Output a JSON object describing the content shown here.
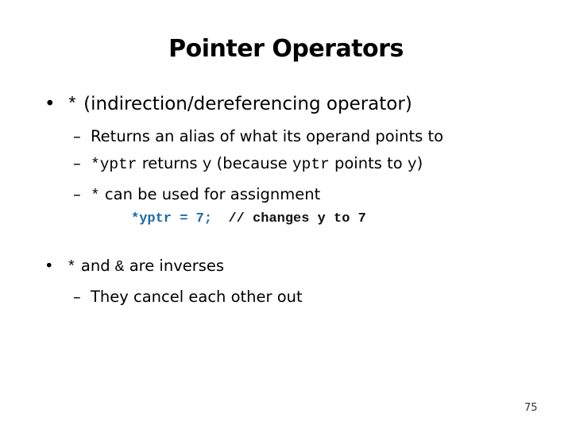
{
  "slide": {
    "title": "Pointer Operators",
    "bullet_symbol": "•",
    "dash_symbol": "–",
    "items": [
      {
        "op": "*",
        "text": " (indirection/dereferencing operator)"
      },
      {
        "text": "Returns an alias of what its operand points to"
      },
      {
        "c1": "*yptr",
        "t1": " returns ",
        "c2": "y",
        "t2": " (because ",
        "c3": "yptr",
        "t3": " points to ",
        "c4": "y",
        "t4": ")"
      },
      {
        "op": "*",
        "text": " can be used for assignment"
      },
      {
        "code": "*yptr = 7;",
        "comment": "// changes y to 7"
      },
      {
        "op1": "*",
        "mid": " and ",
        "op2": "&",
        "text": " are inverses"
      },
      {
        "text": "They cancel each other out"
      }
    ],
    "page_number": "75",
    "colors": {
      "code_accent": "#1a6aa8"
    }
  }
}
